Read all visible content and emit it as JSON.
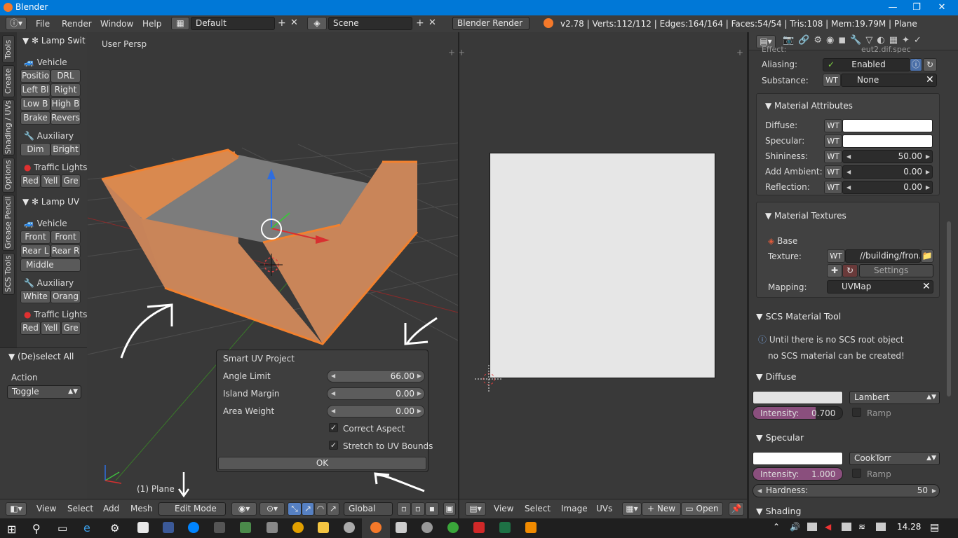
{
  "window": {
    "title": "Blender",
    "min": "—",
    "max": "❐",
    "close": "✕"
  },
  "menubar": {
    "file": "File",
    "render": "Render",
    "window": "Window",
    "help": "Help",
    "layout": "Default",
    "scene": "Scene",
    "engine": "Blender Render",
    "stats": "v2.78 | Verts:112/112 | Edges:164/164 | Faces:54/54 | Tris:108 | Mem:19.79M | Plane"
  },
  "tabs": [
    "Tools",
    "Create",
    "Shading / UVs",
    "Options",
    "Grease Pencil",
    "SCS Tools"
  ],
  "toolshelf": {
    "lamp_switch": "Lamp Swit",
    "vehicle": "Vehicle",
    "vehicle_buttons": [
      "Positio",
      "DRL",
      "Left Bl",
      "Right",
      "Low B",
      "High B",
      "Brake",
      "Revers"
    ],
    "auxiliary": "Auxiliary",
    "aux_buttons": [
      "Dim",
      "Bright"
    ],
    "traffic": "Traffic Lights",
    "traffic_buttons": [
      "Red",
      "Yell",
      "Gre"
    ],
    "lamp_uv": "Lamp UV",
    "vehicle2": "Vehicle",
    "vehicle2_buttons": [
      "Front",
      "Front",
      "Rear L",
      "Rear R",
      "Middle"
    ],
    "auxiliary2": "Auxiliary",
    "aux2_buttons": [
      "White",
      "Orang"
    ],
    "traffic2": "Traffic Lights",
    "traffic2_buttons": [
      "Red",
      "Yell",
      "Gre"
    ]
  },
  "lowerleft": {
    "title": "(De)select All",
    "action_label": "Action",
    "action_value": "Toggle"
  },
  "viewport": {
    "label": "User Persp",
    "object": "(1) Plane"
  },
  "popup": {
    "title": "Smart UV Project",
    "angle_label": "Angle Limit",
    "angle_value": "66.00",
    "island_label": "Island Margin",
    "island_value": "0.00",
    "area_label": "Area Weight",
    "area_value": "0.00",
    "correct_aspect": "Correct Aspect",
    "stretch": "Stretch to UV Bounds",
    "ok": "OK"
  },
  "header3d": {
    "view": "View",
    "select": "Select",
    "add": "Add",
    "mesh": "Mesh",
    "mode": "Edit Mode",
    "orientation": "Global"
  },
  "headeruv": {
    "view": "View",
    "select": "Select",
    "image": "Image",
    "uvs": "UVs",
    "new": "New",
    "open": "Open"
  },
  "props": {
    "effect_label": "Effect:",
    "effect_value": "eut2.dif.spec",
    "aliasing_label": "Aliasing:",
    "aliasing_value": "Enabled",
    "substance_label": "Substance:",
    "substance_value": "None",
    "wt": "WT",
    "mat_attr": "Material Attributes",
    "diffuse_label": "Diffuse:",
    "specular_label": "Specular:",
    "shininess_label": "Shininess:",
    "shininess_value": "50.00",
    "ambient_label": "Add Ambient:",
    "ambient_value": "0.00",
    "reflection_label": "Reflection:",
    "reflection_value": "0.00",
    "mat_tex": "Material Textures",
    "base": "Base",
    "texture_label": "Texture:",
    "texture_value": "//building/fron...",
    "settings": "Settings",
    "mapping_label": "Mapping:",
    "mapping_value": "UVMap",
    "scs_tool": "SCS Material Tool",
    "scs_msg1": "Until there is no SCS root object",
    "scs_msg2": "no SCS material can be created!",
    "diffuse_sec": "Diffuse",
    "diffuse_shader": "Lambert",
    "diffuse_int_label": "Intensity:",
    "diffuse_int": "0.700",
    "ramp": "Ramp",
    "specular_sec": "Specular",
    "spec_shader": "CookTorr",
    "spec_int_label": "Intensity:",
    "spec_int": "1.000",
    "hardness_label": "Hardness:",
    "hardness_value": "50",
    "shading_sec": "Shading"
  },
  "taskbar": {
    "time": "14.28"
  }
}
